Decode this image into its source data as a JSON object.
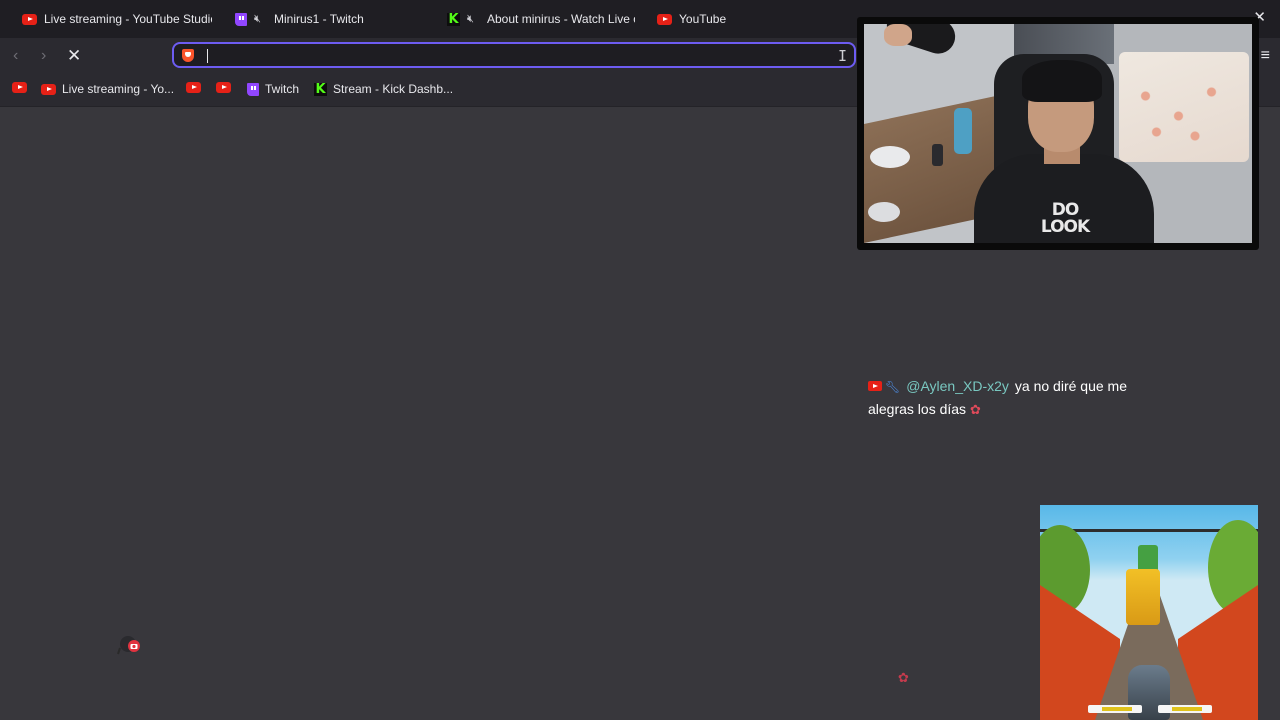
{
  "tabs": [
    {
      "label": "Live streaming - YouTube Studio",
      "icon": "youtube-icon",
      "muted": false
    },
    {
      "label": "Minirus1 - Twitch",
      "icon": "twitch-icon",
      "muted": true
    },
    {
      "label": "About minirus - Watch Live on",
      "icon": "kick-icon",
      "muted": true
    },
    {
      "label": "YouTube",
      "icon": "youtube-icon",
      "muted": false
    }
  ],
  "toolbar": {
    "back": "‹",
    "forward": "›",
    "stop": "✕",
    "address_value": "",
    "menu": "≡",
    "window_close": "✕"
  },
  "bookmarks": [
    {
      "label": "",
      "icon": "youtube-icon"
    },
    {
      "label": "Live streaming - Yo...",
      "icon": "youtube-icon"
    },
    {
      "label": "",
      "icon": "youtube-icon"
    },
    {
      "label": "",
      "icon": "youtube-icon"
    },
    {
      "label": "Twitch",
      "icon": "twitch-icon"
    },
    {
      "label": "Stream - Kick Dashb...",
      "icon": "kick-icon"
    }
  ],
  "chat": {
    "username": "@Aylen_XD-x2y",
    "message": "ya no diré que me alegras los días"
  },
  "webcam": {
    "shirt_text": "DO LOOK"
  },
  "colors": {
    "accent": "#6d5cf2",
    "page_bg": "#38373c",
    "tabstrip_bg": "#1f1e23",
    "youtube_red": "#e62117",
    "twitch_purple": "#9146ff",
    "kick_green": "#53fc18",
    "chat_username": "#79c7c0"
  }
}
